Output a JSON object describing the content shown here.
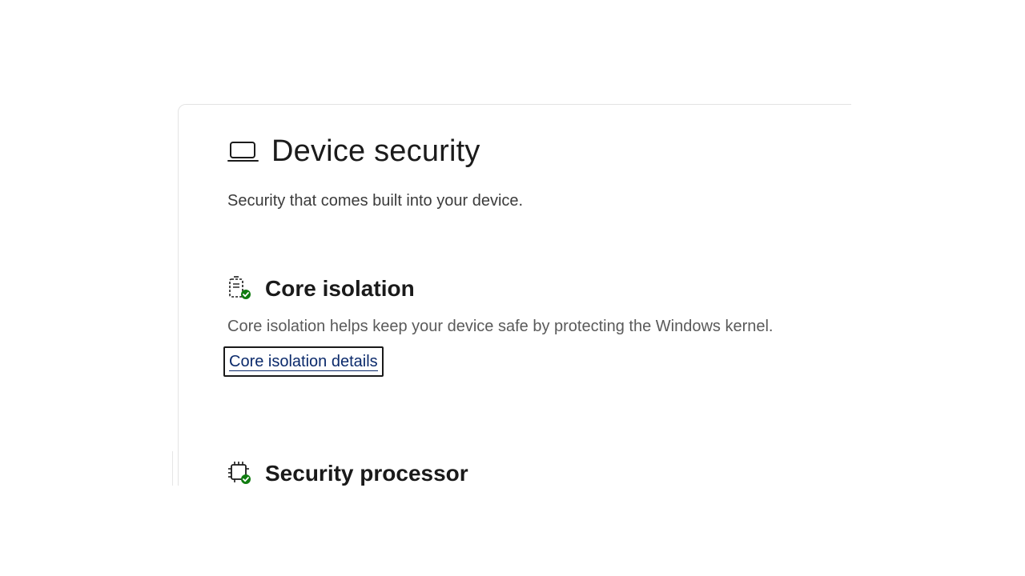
{
  "page": {
    "title": "Device security",
    "subtitle": "Security that comes built into your device.",
    "icon": "laptop-icon"
  },
  "sections": [
    {
      "title": "Core isolation",
      "icon": "core-isolation-icon",
      "description": "Core isolation helps keep your device safe by protecting the Windows kernel.",
      "link_label": "Core isolation details"
    },
    {
      "title": "Security processor",
      "icon": "security-processor-icon"
    }
  ],
  "colors": {
    "status_ok": "#107c10",
    "link": "#0b2a6b",
    "focus_border": "#1a1a1a"
  }
}
